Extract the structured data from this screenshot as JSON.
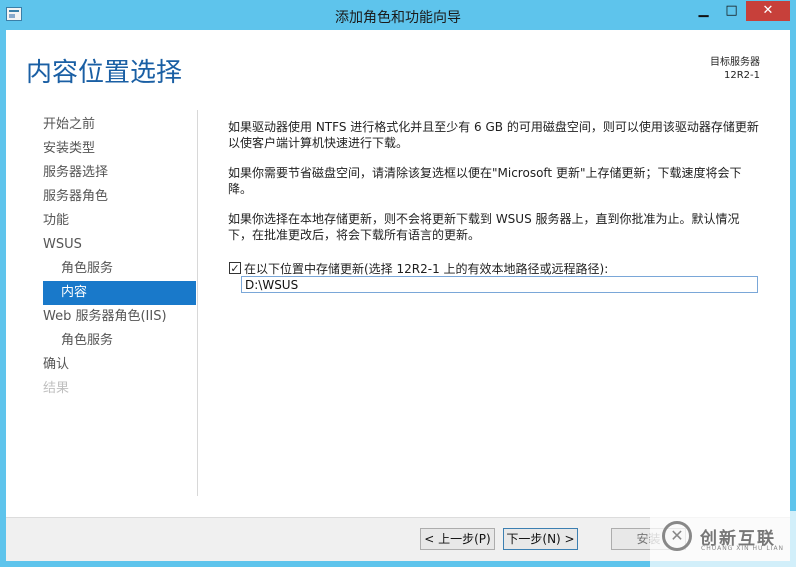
{
  "window": {
    "title": "添加角色和功能向导",
    "min_glyph": "▁",
    "max_glyph": "□",
    "close_glyph": "✕"
  },
  "page": {
    "heading": "内容位置选择",
    "server_label": "目标服务器",
    "server_name": "12R2-1"
  },
  "nav": {
    "items": [
      {
        "label": "开始之前",
        "state": "normal"
      },
      {
        "label": "安装类型",
        "state": "normal"
      },
      {
        "label": "服务器选择",
        "state": "normal"
      },
      {
        "label": "服务器角色",
        "state": "normal"
      },
      {
        "label": "功能",
        "state": "normal"
      },
      {
        "label": "WSUS",
        "state": "normal"
      },
      {
        "label": "角色服务",
        "state": "sub"
      },
      {
        "label": "内容",
        "state": "active"
      },
      {
        "label": "Web 服务器角色(IIS)",
        "state": "normal"
      },
      {
        "label": "角色服务",
        "state": "sub"
      },
      {
        "label": "确认",
        "state": "normal"
      },
      {
        "label": "结果",
        "state": "disabled"
      }
    ]
  },
  "main": {
    "para1": "如果驱动器使用 NTFS 进行格式化并且至少有 6 GB 的可用磁盘空间，则可以使用该驱动器存储更新以使客户端计算机快速进行下载。",
    "para2": "如果你需要节省磁盘空间，请清除该复选框以便在\"Microsoft 更新\"上存储更新；下载速度将会下降。",
    "para3": "如果你选择在本地存储更新，则不会将更新下载到 WSUS 服务器上，直到你批准为止。默认情况下，在批准更改后，将会下载所有语言的更新。",
    "checkbox_label": "在以下位置中存储更新(选择 12R2-1 上的有效本地路径或远程路径):",
    "checkbox_checked": true,
    "checkbox_glyph": "✓",
    "path_value": "D:\\WSUS"
  },
  "footer": {
    "prev_label": "< 上一步(P)",
    "next_label": "下一步(N) >",
    "install_label": "安装"
  },
  "watermark": {
    "mark": "✕",
    "text": "创新互联",
    "subtext": "CHUANG XIN HU LIAN"
  },
  "colors": {
    "frame": "#5ec4ec",
    "heading": "#1a5fa4",
    "nav_active": "#1979ca",
    "close_button": "#c7403a"
  }
}
